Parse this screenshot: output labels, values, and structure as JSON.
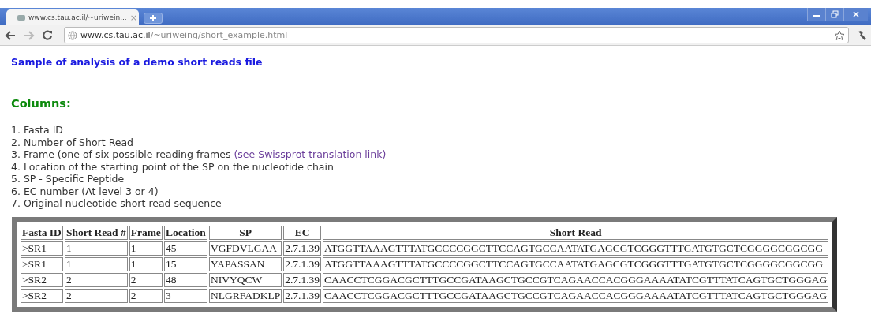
{
  "browser": {
    "tabs": [
      {
        "title": "www.cs.tau.ac.il/~uriwein...",
        "close": "×",
        "selected": true
      }
    ],
    "address": {
      "host": "www.cs.tau.ac.il",
      "path": "/~uriweing/short_example.html"
    }
  },
  "page": {
    "title": "Sample of analysis of a demo short reads file",
    "heading": "Columns:",
    "columns_list": [
      {
        "text": "1. Fasta ID"
      },
      {
        "text": "2. Number of Short Read"
      },
      {
        "text": "3. Frame (one of six possible reading frames ",
        "link": "(see Swissprot translation link)"
      },
      {
        "text": "4. Location of the starting point of the SP on the nucleotide chain"
      },
      {
        "text": "5. SP - Specific Peptide"
      },
      {
        "text": "6. EC number (At level 3 or 4)"
      },
      {
        "text": "7. Original nucleotide short read sequence"
      }
    ],
    "table": {
      "columns": [
        "Fasta ID",
        "Short Read #",
        "Frame",
        "Location",
        "SP",
        "EC",
        "Short Read"
      ],
      "rows": [
        [
          ">SR1",
          "1",
          "1",
          "45",
          "VGFDVLGAA",
          "2.7.1.39",
          "ATGGTTAAAGTTTATGCCCCGGCTTCCAGTGCCAATATGAGCGTCGGGTTTGATGTGCTCGGGGCGGCGG"
        ],
        [
          ">SR1",
          "1",
          "1",
          "15",
          "YAPASSAN",
          "2.7.1.39",
          "ATGGTTAAAGTTTATGCCCCGGCTTCCAGTGCCAATATGAGCGTCGGGTTTGATGTGCTCGGGGCGGCGG"
        ],
        [
          ">SR2",
          "2",
          "2",
          "48",
          "NIVYQCW",
          "2.7.1.39",
          "CAACCTCGGACGCTTTGCCGATAAGCTGCCGTCAGAACCACGGGAAAATATCGTTTATCAGTGCTGGGAG"
        ],
        [
          ">SR2",
          "2",
          "2",
          "3",
          "NLGRFADKLP",
          "2.7.1.39",
          "CAACCTCGGACGCTTTGCCGATAAGCTGCCGTCAGAACCACGGGAAAATATCGTTTATCAGTGCTGGGAG"
        ]
      ]
    }
  }
}
